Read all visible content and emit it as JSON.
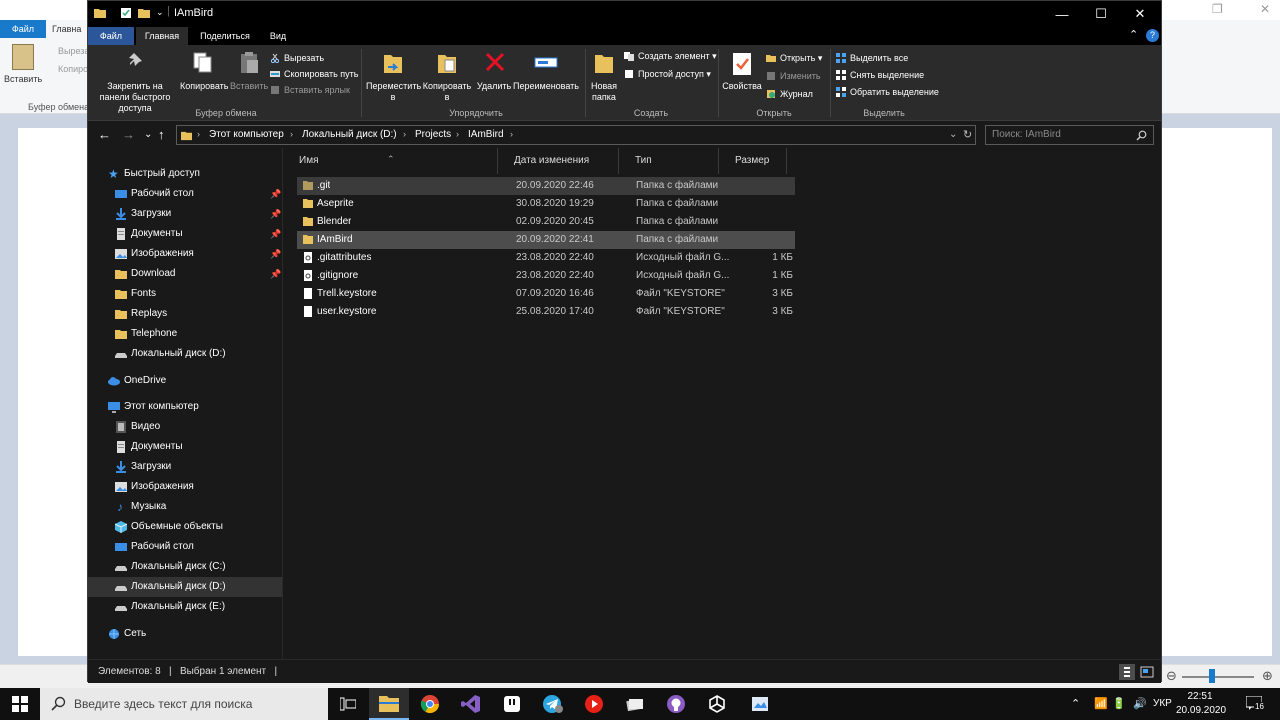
{
  "background_app": {
    "file_tab": "Файл",
    "home_tab": "Главна",
    "clipboard_label": "Буфер обмена",
    "paste_label": "Вставить",
    "cut_label": "Выреза",
    "copy_label": "Копиро"
  },
  "explorer": {
    "title": "IAmBird",
    "window_controls": {
      "minimize": "—",
      "maximize": "☐",
      "close": "✕"
    },
    "tabs": [
      "Файл",
      "Главная",
      "Поделиться",
      "Вид"
    ],
    "ribbon": {
      "pin_label": "Закрепить на панели быстрого доступа",
      "copy_label": "Копировать",
      "paste_label": "Вставить",
      "cut_label": "Вырезать",
      "copy_path_label": "Скопировать путь",
      "paste_shortcut_label": "Вставить ярлык",
      "group_clipboard": "Буфер обмена",
      "move_label": "Переместить в",
      "copy_to_label": "Копировать в",
      "delete_label": "Удалить",
      "rename_label": "Переименовать",
      "group_organize": "Упорядочить",
      "new_folder_label": "Новая папка",
      "new_item_label": "Создать элемент",
      "easy_access_label": "Простой доступ",
      "group_create": "Создать",
      "properties_label": "Свойства",
      "open_label": "Открыть",
      "edit_label": "Изменить",
      "history_label": "Журнал",
      "group_open": "Открыть",
      "select_all_label": "Выделить все",
      "select_none_label": "Снять выделение",
      "invert_selection_label": "Обратить выделение",
      "group_select": "Выделить"
    },
    "breadcrumbs": [
      "Этот компьютер",
      "Локальный диск (D:)",
      "Projects",
      "IAmBird"
    ],
    "search_placeholder": "Поиск: IAmBird",
    "sidebar": {
      "quick_access": "Быстрый доступ",
      "quick_items": [
        "Рабочий стол",
        "Загрузки",
        "Документы",
        "Изображения",
        "Download",
        "Fonts",
        "Replays",
        "Telephone",
        "Локальный диск (D:)"
      ],
      "onedrive": "OneDrive",
      "this_pc": "Этот компьютер",
      "pc_items": [
        "Видео",
        "Документы",
        "Загрузки",
        "Изображения",
        "Музыка",
        "Объемные объекты",
        "Рабочий стол",
        "Локальный диск (C:)",
        "Локальный диск (D:)",
        "Локальный диск (E:)"
      ],
      "network": "Сеть"
    },
    "columns": [
      "Имя",
      "Дата изменения",
      "Тип",
      "Размер"
    ],
    "files": [
      {
        "name": ".git",
        "date": "20.09.2020 22:46",
        "type": "Папка с файлами",
        "size": ""
      },
      {
        "name": "Aseprite",
        "date": "30.08.2020 19:29",
        "type": "Папка с файлами",
        "size": ""
      },
      {
        "name": "Blender",
        "date": "02.09.2020 20:45",
        "type": "Папка с файлами",
        "size": ""
      },
      {
        "name": "IAmBird",
        "date": "20.09.2020 22:41",
        "type": "Папка с файлами",
        "size": ""
      },
      {
        "name": ".gitattributes",
        "date": "23.08.2020 22:40",
        "type": "Исходный файл G...",
        "size": "1 КБ"
      },
      {
        "name": ".gitignore",
        "date": "23.08.2020 22:40",
        "type": "Исходный файл G...",
        "size": "1 КБ"
      },
      {
        "name": "Trell.keystore",
        "date": "07.09.2020 16:46",
        "type": "Файл \"KEYSTORE\"",
        "size": "3 КБ"
      },
      {
        "name": "user.keystore",
        "date": "25.08.2020 17:40",
        "type": "Файл \"KEYSTORE\"",
        "size": "3 КБ"
      }
    ],
    "status": "Элементов: 8   |   Выбран 1 элемент   |"
  },
  "taskbar": {
    "search_text": "Введите здесь текст для поиска",
    "lang": "УКР",
    "time": "22:51",
    "date": "20.09.2020",
    "notifications": "16"
  },
  "colors": {
    "accent": "#2b579a",
    "folder": "#e8c15c",
    "selection": "#4d4d4d"
  }
}
